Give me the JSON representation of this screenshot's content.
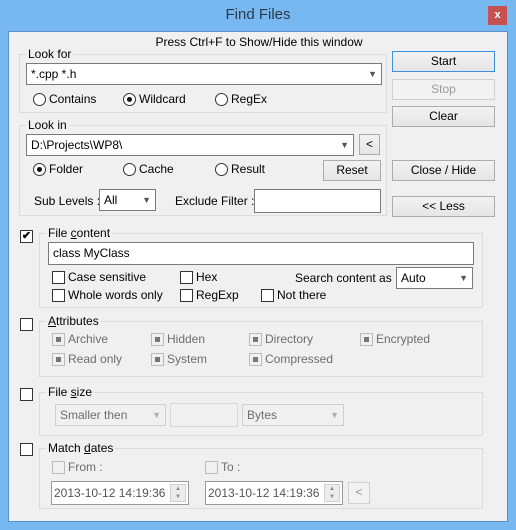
{
  "window": {
    "title": "Find Files",
    "close_label": "x"
  },
  "hint": "Press Ctrl+F to Show/Hide this window",
  "look_for": {
    "label": "Look for",
    "value": "*.cpp *.h",
    "modes": [
      {
        "label": "Contains",
        "selected": false
      },
      {
        "label": "Wildcard",
        "selected": true
      },
      {
        "label": "RegEx",
        "selected": false
      }
    ]
  },
  "look_in": {
    "label": "Look in",
    "value": "D:\\Projects\\WP8\\",
    "back_label": "<",
    "sources": [
      {
        "label": "Folder",
        "selected": true
      },
      {
        "label": "Cache",
        "selected": false
      },
      {
        "label": "Result",
        "selected": false
      }
    ],
    "reset_label": "Reset",
    "sub_levels_label": "Sub Levels :",
    "sub_levels_value": "All",
    "exclude_label": "Exclude Filter :",
    "exclude_value": ""
  },
  "buttons": {
    "start": "Start",
    "stop": "Stop",
    "clear": "Clear",
    "close_hide": "Close / Hide",
    "less": "<< Less"
  },
  "file_content": {
    "enabled": true,
    "label_pre": "File ",
    "label_ul": "c",
    "label_post": "ontent",
    "value": "class MyClass",
    "case_sensitive": "Case sensitive",
    "hex": "Hex",
    "whole_words": "Whole words only",
    "regexp": "RegExp",
    "not_there": "Not there",
    "search_as_label": "Search content as :",
    "search_as_value": "Auto"
  },
  "attributes": {
    "enabled": false,
    "label_ul": "A",
    "label_post": "ttributes",
    "items": [
      "Archive",
      "Hidden",
      "Directory",
      "Encrypted",
      "Read only",
      "System",
      "Compressed"
    ]
  },
  "file_size": {
    "enabled": false,
    "label_pre": "File ",
    "label_ul": "s",
    "label_post": "ize",
    "comparator": "Smaller then",
    "value": "",
    "unit": "Bytes"
  },
  "match_dates": {
    "enabled": false,
    "label_pre": "Match ",
    "label_ul": "d",
    "label_post": "ates",
    "from_label": "From :",
    "to_label": "To :",
    "from_value": "2013-10-12 14:19:36",
    "to_value": "2013-10-12 14:19:36",
    "copy_label": "<"
  }
}
